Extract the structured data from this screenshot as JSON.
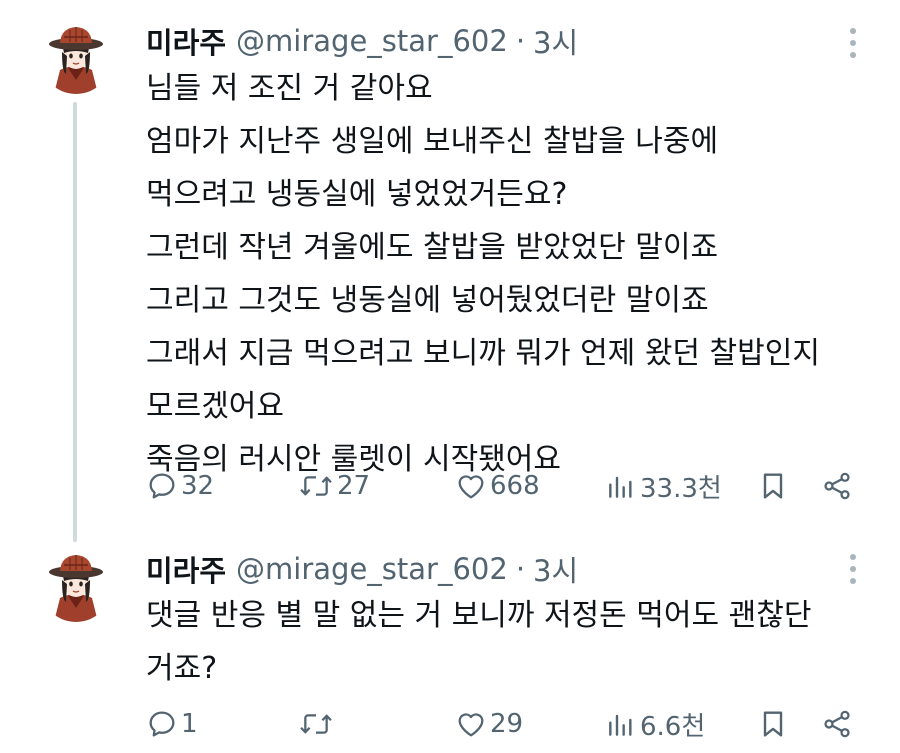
{
  "colors": {
    "text_primary": "#0f1419",
    "text_secondary": "#536471",
    "thread_line": "#cfd9de"
  },
  "tweets": [
    {
      "author": {
        "name": "미라주",
        "handle": "@mirage_star_602",
        "avatar_icon": "avatar-illustration-icon"
      },
      "separator": "·",
      "time": "3시",
      "lines": [
        "님들 저 조진 거 같아요",
        "엄마가 지난주 생일에 보내주신 찰밥을 나중에",
        "먹으려고 냉동실에 넣었었거든요?",
        "그런데 작년 겨울에도 찰밥을 받았었단 말이죠",
        "그리고 그것도 냉동실에 넣어뒀었더란 말이죠",
        "그래서 지금 먹으려고 보니까 뭐가 언제 왔던 찰밥인지",
        "모르겠어요",
        "죽음의 러시안 룰렛이 시작됐어요"
      ],
      "stats": {
        "replies": "32",
        "retweets": "27",
        "likes": "668",
        "views": "33.3천"
      }
    },
    {
      "author": {
        "name": "미라주",
        "handle": "@mirage_star_602",
        "avatar_icon": "avatar-illustration-icon"
      },
      "separator": "·",
      "time": "3시",
      "lines": [
        "댓글 반응 별 말 없는 거 보니까 저정돈 먹어도 괜찮단",
        "거죠?"
      ],
      "stats": {
        "replies": "1",
        "retweets": "",
        "likes": "29",
        "views": "6.6천"
      }
    }
  ]
}
